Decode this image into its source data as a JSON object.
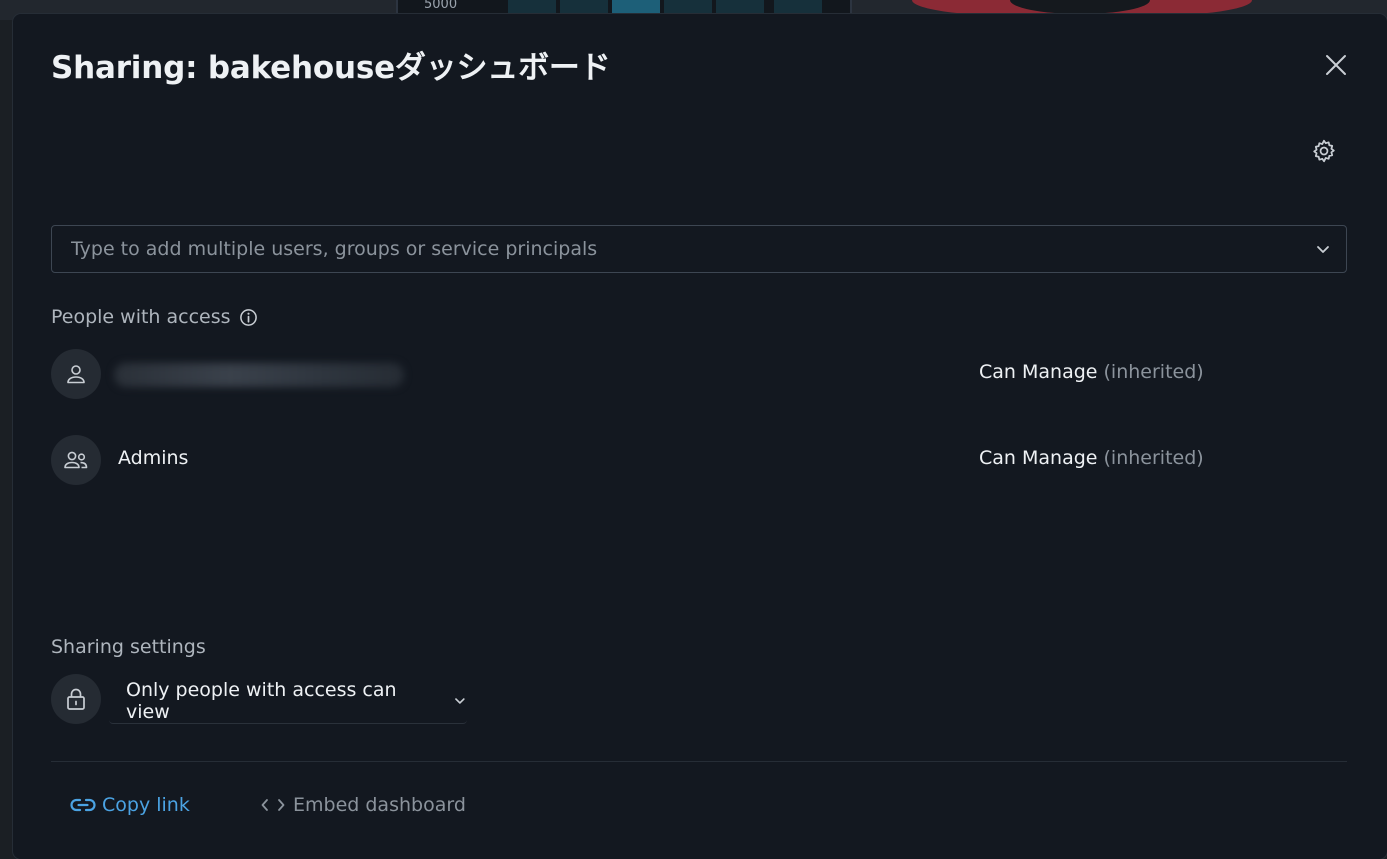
{
  "dialog": {
    "title": "Sharing: bakehouseダッシュボード"
  },
  "background": {
    "axis_tick": "5000"
  },
  "search": {
    "placeholder": "Type to add multiple users, groups or service principals"
  },
  "people_section": {
    "label": "People with access",
    "entries": [
      {
        "name": "",
        "permission": "Can Manage",
        "inherited": "(inherited)",
        "icon": "user-icon",
        "name_blurred": true
      },
      {
        "name": "Admins",
        "permission": "Can Manage",
        "inherited": "(inherited)",
        "icon": "group-icon"
      }
    ]
  },
  "sharing_settings": {
    "label": "Sharing settings",
    "selected": "Only people with access can view"
  },
  "footer": {
    "copy_link": "Copy link",
    "embed": "Embed dashboard"
  },
  "colors": {
    "modal_bg": "#131820",
    "link": "#4ba3e3",
    "muted": "#8b939c"
  }
}
